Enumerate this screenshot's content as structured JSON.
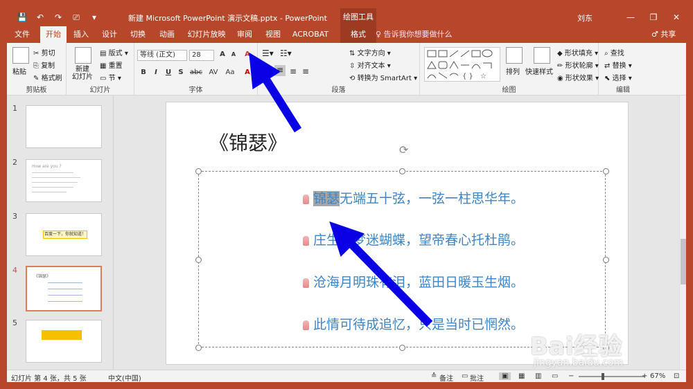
{
  "titlebar": {
    "doc_title": "新建 Microsoft PowerPoint 演示文稿.pptx  -  PowerPoint",
    "tools_tab": "绘图工具",
    "user": "刘东",
    "save_icon": "💾",
    "undo_icon": "↶",
    "redo_icon": "↷",
    "present_icon": "⎚",
    "customize_icon": "▾",
    "min": "—",
    "restore": "❐",
    "close": "✕"
  },
  "tabs": [
    {
      "label": "文件"
    },
    {
      "label": "开始"
    },
    {
      "label": "插入"
    },
    {
      "label": "设计"
    },
    {
      "label": "切换"
    },
    {
      "label": "动画"
    },
    {
      "label": "幻灯片放映"
    },
    {
      "label": "审阅"
    },
    {
      "label": "视图"
    },
    {
      "label": "ACROBAT"
    },
    {
      "label": "格式"
    }
  ],
  "tellme": "♀ 告诉我你想要做什么",
  "share": "♂ 共享",
  "ribbon": {
    "clipboard": {
      "paste": "粘贴",
      "cut": "剪切",
      "copy": "复制",
      "format_painter": "格式刷",
      "label": "剪贴板"
    },
    "slides": {
      "new_slide": "新建\n幻灯片",
      "layout": "版式",
      "reset": "重置",
      "section": "节",
      "label": "幻灯片"
    },
    "font": {
      "name": "等线 (正文)",
      "size": "28",
      "label": "字体",
      "bold": "B",
      "italic": "I",
      "underline": "U",
      "shadow": "S",
      "strike": "abc",
      "spacing": "AV",
      "case": "Aa",
      "grow": "A",
      "shrink": "A",
      "clear": "A"
    },
    "paragraph": {
      "text_direction": "文字方向",
      "align_text": "对齐文本",
      "smartart": "转换为 SmartArt",
      "label": "段落"
    },
    "drawing": {
      "arrange": "排列",
      "quick_styles": "快速样式",
      "fill": "形状填充",
      "outline": "形状轮廓",
      "effects": "形状效果",
      "label": "绘图"
    },
    "editing": {
      "find": "查找",
      "replace": "替换",
      "select": "选择",
      "label": "编辑"
    }
  },
  "thumbnails": [
    {
      "num": "1"
    },
    {
      "num": "2",
      "line1": "How are you ?"
    },
    {
      "num": "3",
      "line1": "百度一下，你就知道！"
    },
    {
      "num": "4",
      "line1": "《锦瑟》"
    },
    {
      "num": "5"
    }
  ],
  "slide": {
    "title": "《锦瑟》",
    "lines": [
      {
        "pre": "",
        "hl": "锦瑟",
        "post": "无端五十弦，一弦一柱思华年。"
      },
      {
        "pre": "庄生晓梦迷蝴蝶，望帝春心托杜鹃。",
        "hl": "",
        "post": ""
      },
      {
        "pre": "沧海月明珠有泪，蓝田日暖玉生烟。",
        "hl": "",
        "post": ""
      },
      {
        "pre": "此情可待成追忆，只是当时已惘然。",
        "hl": "",
        "post": ""
      }
    ]
  },
  "status": {
    "slide_info": "幻灯片 第 4 张，共 5 张",
    "language": "中文(中国)",
    "notes": "备注",
    "comments": "批注",
    "zoom": "67%"
  },
  "watermark": {
    "brand": "Bai经验",
    "url": "jingyan.baidu.com"
  },
  "colors": {
    "accent": "#b7472a",
    "text_blue": "#3d85c6",
    "arrow": "#0a00e6"
  }
}
